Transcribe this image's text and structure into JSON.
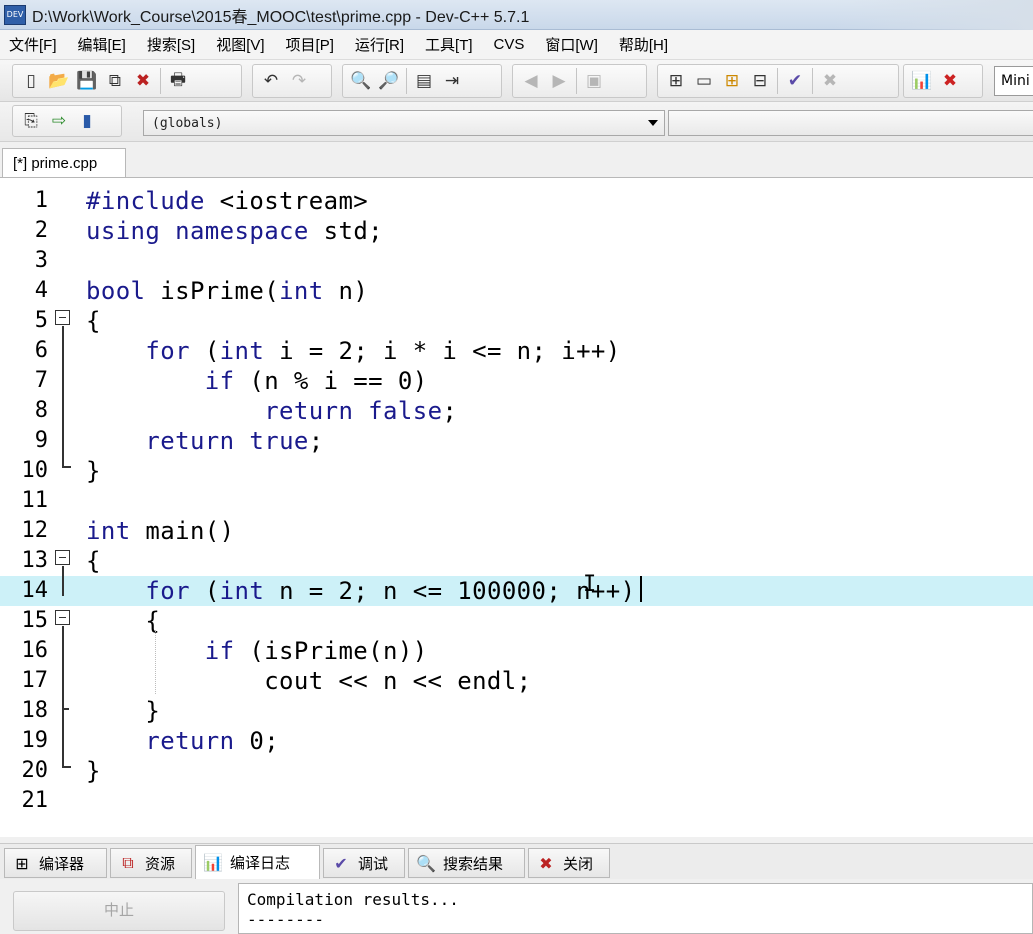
{
  "window": {
    "title": "D:\\Work\\Work_Course\\2015春_MOOC\\test\\prime.cpp - Dev-C++ 5.7.1",
    "app_icon_text": "DEV"
  },
  "menu": [
    "文件[F]",
    "编辑[E]",
    "搜索[S]",
    "视图[V]",
    "项目[P]",
    "运行[R]",
    "工具[T]",
    "CVS",
    "窗口[W]",
    "帮助[H]"
  ],
  "toolbar": {
    "mini_box_text": "Mini"
  },
  "scope": {
    "selected": "(globals)"
  },
  "editor": {
    "tab_label": "[*] prime.cpp",
    "lines": [
      {
        "n": "1",
        "code": "#include <iostream>"
      },
      {
        "n": "2",
        "code": "using namespace std;"
      },
      {
        "n": "3",
        "code": ""
      },
      {
        "n": "4",
        "code": "bool isPrime(int n)"
      },
      {
        "n": "5",
        "code": "{"
      },
      {
        "n": "6",
        "code": "    for (int i = 2; i * i <= n; i++)"
      },
      {
        "n": "7",
        "code": "        if (n % i == 0)"
      },
      {
        "n": "8",
        "code": "            return false;"
      },
      {
        "n": "9",
        "code": "    return true;"
      },
      {
        "n": "10",
        "code": "}"
      },
      {
        "n": "11",
        "code": ""
      },
      {
        "n": "12",
        "code": "int main()"
      },
      {
        "n": "13",
        "code": "{"
      },
      {
        "n": "14",
        "code": "    for (int n = 2; n <= 100000; n++)"
      },
      {
        "n": "15",
        "code": "    {"
      },
      {
        "n": "16",
        "code": "        if (isPrime(n))"
      },
      {
        "n": "17",
        "code": "            cout << n << endl;"
      },
      {
        "n": "18",
        "code": "    }"
      },
      {
        "n": "19",
        "code": "    return 0;"
      },
      {
        "n": "20",
        "code": "}"
      },
      {
        "n": "21",
        "code": ""
      }
    ],
    "active_line": 14
  },
  "bottom": {
    "tabs": [
      {
        "label": "编译器",
        "icon": "grid-icon"
      },
      {
        "label": "资源",
        "icon": "resource-icon"
      },
      {
        "label": "编译日志",
        "icon": "bar-chart-icon"
      },
      {
        "label": "调试",
        "icon": "check-icon"
      },
      {
        "label": "搜索结果",
        "icon": "search-results-icon"
      },
      {
        "label": "关闭",
        "icon": "close-icon"
      }
    ],
    "active_tab": "编译日志",
    "stop_label": "中止",
    "log_text": "Compilation results...\n--------"
  }
}
